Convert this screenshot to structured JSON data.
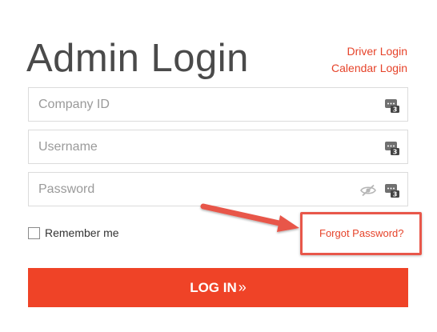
{
  "header": {
    "title": "Admin Login",
    "driver_login": "Driver Login",
    "calendar_login": "Calendar Login"
  },
  "form": {
    "company_id": {
      "placeholder": "Company ID",
      "value": ""
    },
    "username": {
      "placeholder": "Username",
      "value": ""
    },
    "password": {
      "placeholder": "Password",
      "value": ""
    },
    "remember_label": "Remember me",
    "remember_checked": false,
    "forgot_label": "Forgot Password?",
    "login_label": "LOG IN",
    "login_chevron": "»"
  },
  "icons": {
    "field_keyboard": "keyboard-icon",
    "password_visibility": "eye-slash-icon",
    "annotation_arrow": "arrow-icon"
  },
  "colors": {
    "accent": "#ef4327",
    "link": "#e6432a",
    "annotation": "#e8574a",
    "title": "#4a4a4a",
    "border": "#dcdcdc"
  }
}
